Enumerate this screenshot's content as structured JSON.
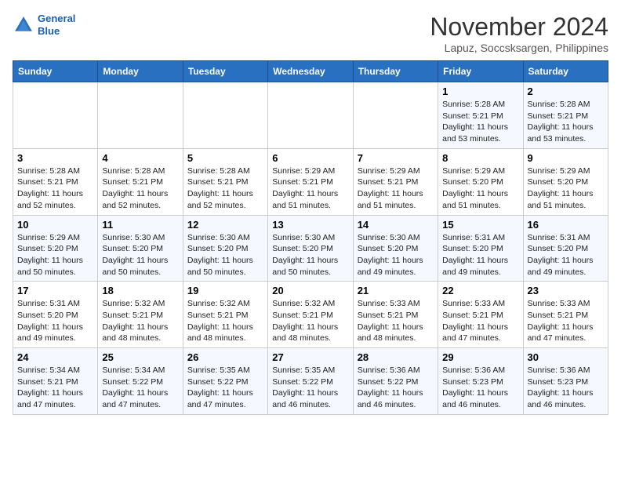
{
  "header": {
    "logo_line1": "General",
    "logo_line2": "Blue",
    "month": "November 2024",
    "location": "Lapuz, Soccsksargen, Philippines"
  },
  "weekdays": [
    "Sunday",
    "Monday",
    "Tuesday",
    "Wednesday",
    "Thursday",
    "Friday",
    "Saturday"
  ],
  "weeks": [
    [
      {
        "day": null
      },
      {
        "day": null
      },
      {
        "day": null
      },
      {
        "day": null
      },
      {
        "day": null
      },
      {
        "day": "1",
        "sunrise": "5:28 AM",
        "sunset": "5:21 PM",
        "daylight": "11 hours and 53 minutes."
      },
      {
        "day": "2",
        "sunrise": "5:28 AM",
        "sunset": "5:21 PM",
        "daylight": "11 hours and 53 minutes."
      }
    ],
    [
      {
        "day": "3",
        "sunrise": "5:28 AM",
        "sunset": "5:21 PM",
        "daylight": "11 hours and 52 minutes."
      },
      {
        "day": "4",
        "sunrise": "5:28 AM",
        "sunset": "5:21 PM",
        "daylight": "11 hours and 52 minutes."
      },
      {
        "day": "5",
        "sunrise": "5:28 AM",
        "sunset": "5:21 PM",
        "daylight": "11 hours and 52 minutes."
      },
      {
        "day": "6",
        "sunrise": "5:29 AM",
        "sunset": "5:21 PM",
        "daylight": "11 hours and 51 minutes."
      },
      {
        "day": "7",
        "sunrise": "5:29 AM",
        "sunset": "5:21 PM",
        "daylight": "11 hours and 51 minutes."
      },
      {
        "day": "8",
        "sunrise": "5:29 AM",
        "sunset": "5:20 PM",
        "daylight": "11 hours and 51 minutes."
      },
      {
        "day": "9",
        "sunrise": "5:29 AM",
        "sunset": "5:20 PM",
        "daylight": "11 hours and 51 minutes."
      }
    ],
    [
      {
        "day": "10",
        "sunrise": "5:29 AM",
        "sunset": "5:20 PM",
        "daylight": "11 hours and 50 minutes."
      },
      {
        "day": "11",
        "sunrise": "5:30 AM",
        "sunset": "5:20 PM",
        "daylight": "11 hours and 50 minutes."
      },
      {
        "day": "12",
        "sunrise": "5:30 AM",
        "sunset": "5:20 PM",
        "daylight": "11 hours and 50 minutes."
      },
      {
        "day": "13",
        "sunrise": "5:30 AM",
        "sunset": "5:20 PM",
        "daylight": "11 hours and 50 minutes."
      },
      {
        "day": "14",
        "sunrise": "5:30 AM",
        "sunset": "5:20 PM",
        "daylight": "11 hours and 49 minutes."
      },
      {
        "day": "15",
        "sunrise": "5:31 AM",
        "sunset": "5:20 PM",
        "daylight": "11 hours and 49 minutes."
      },
      {
        "day": "16",
        "sunrise": "5:31 AM",
        "sunset": "5:20 PM",
        "daylight": "11 hours and 49 minutes."
      }
    ],
    [
      {
        "day": "17",
        "sunrise": "5:31 AM",
        "sunset": "5:20 PM",
        "daylight": "11 hours and 49 minutes."
      },
      {
        "day": "18",
        "sunrise": "5:32 AM",
        "sunset": "5:21 PM",
        "daylight": "11 hours and 48 minutes."
      },
      {
        "day": "19",
        "sunrise": "5:32 AM",
        "sunset": "5:21 PM",
        "daylight": "11 hours and 48 minutes."
      },
      {
        "day": "20",
        "sunrise": "5:32 AM",
        "sunset": "5:21 PM",
        "daylight": "11 hours and 48 minutes."
      },
      {
        "day": "21",
        "sunrise": "5:33 AM",
        "sunset": "5:21 PM",
        "daylight": "11 hours and 48 minutes."
      },
      {
        "day": "22",
        "sunrise": "5:33 AM",
        "sunset": "5:21 PM",
        "daylight": "11 hours and 47 minutes."
      },
      {
        "day": "23",
        "sunrise": "5:33 AM",
        "sunset": "5:21 PM",
        "daylight": "11 hours and 47 minutes."
      }
    ],
    [
      {
        "day": "24",
        "sunrise": "5:34 AM",
        "sunset": "5:21 PM",
        "daylight": "11 hours and 47 minutes."
      },
      {
        "day": "25",
        "sunrise": "5:34 AM",
        "sunset": "5:22 PM",
        "daylight": "11 hours and 47 minutes."
      },
      {
        "day": "26",
        "sunrise": "5:35 AM",
        "sunset": "5:22 PM",
        "daylight": "11 hours and 47 minutes."
      },
      {
        "day": "27",
        "sunrise": "5:35 AM",
        "sunset": "5:22 PM",
        "daylight": "11 hours and 46 minutes."
      },
      {
        "day": "28",
        "sunrise": "5:36 AM",
        "sunset": "5:22 PM",
        "daylight": "11 hours and 46 minutes."
      },
      {
        "day": "29",
        "sunrise": "5:36 AM",
        "sunset": "5:23 PM",
        "daylight": "11 hours and 46 minutes."
      },
      {
        "day": "30",
        "sunrise": "5:36 AM",
        "sunset": "5:23 PM",
        "daylight": "11 hours and 46 minutes."
      }
    ]
  ]
}
